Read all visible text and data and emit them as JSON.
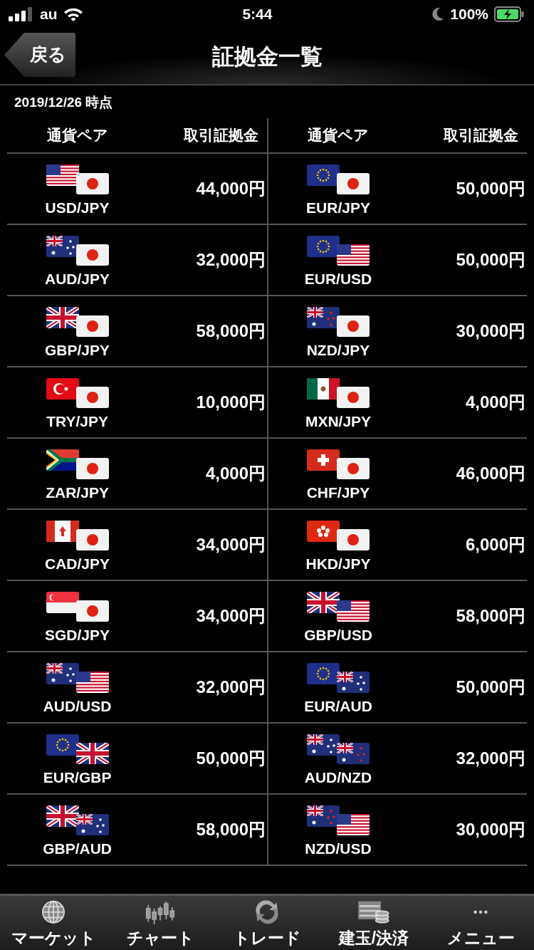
{
  "status_bar": {
    "carrier": "au",
    "time": "5:44",
    "battery": "100%"
  },
  "nav": {
    "back": "戻る",
    "title": "証拠金一覧"
  },
  "as_of": "2019/12/26 時点",
  "columns": [
    "通貨ペア",
    "取引証拠金",
    "通貨ペア",
    "取引証拠金"
  ],
  "rows": [
    {
      "cells": [
        {
          "pair": "USD/JPY",
          "margin": "44,000円"
        },
        {
          "pair": "EUR/JPY",
          "margin": "50,000円"
        }
      ]
    },
    {
      "cells": [
        {
          "pair": "AUD/JPY",
          "margin": "32,000円"
        },
        {
          "pair": "EUR/USD",
          "margin": "50,000円"
        }
      ]
    },
    {
      "cells": [
        {
          "pair": "GBP/JPY",
          "margin": "58,000円"
        },
        {
          "pair": "NZD/JPY",
          "margin": "30,000円"
        }
      ]
    },
    {
      "cells": [
        {
          "pair": "TRY/JPY",
          "margin": "10,000円"
        },
        {
          "pair": "MXN/JPY",
          "margin": "4,000円"
        }
      ]
    },
    {
      "cells": [
        {
          "pair": "ZAR/JPY",
          "margin": "4,000円"
        },
        {
          "pair": "CHF/JPY",
          "margin": "46,000円"
        }
      ]
    },
    {
      "cells": [
        {
          "pair": "CAD/JPY",
          "margin": "34,000円"
        },
        {
          "pair": "HKD/JPY",
          "margin": "6,000円"
        }
      ]
    },
    {
      "cells": [
        {
          "pair": "SGD/JPY",
          "margin": "34,000円"
        },
        {
          "pair": "GBP/USD",
          "margin": "58,000円"
        }
      ]
    },
    {
      "cells": [
        {
          "pair": "AUD/USD",
          "margin": "32,000円"
        },
        {
          "pair": "EUR/AUD",
          "margin": "50,000円"
        }
      ]
    },
    {
      "cells": [
        {
          "pair": "EUR/GBP",
          "margin": "50,000円"
        },
        {
          "pair": "AUD/NZD",
          "margin": "32,000円"
        }
      ]
    },
    {
      "cells": [
        {
          "pair": "GBP/AUD",
          "margin": "58,000円"
        },
        {
          "pair": "NZD/USD",
          "margin": "30,000円"
        }
      ]
    }
  ],
  "tabs": [
    {
      "label": "マーケット",
      "kind": "globe"
    },
    {
      "label": "チャート",
      "kind": "chart"
    },
    {
      "label": "トレード",
      "kind": "trade"
    },
    {
      "label": "建玉/決済",
      "kind": "coins"
    },
    {
      "label": "メニュー",
      "kind": "more"
    }
  ]
}
